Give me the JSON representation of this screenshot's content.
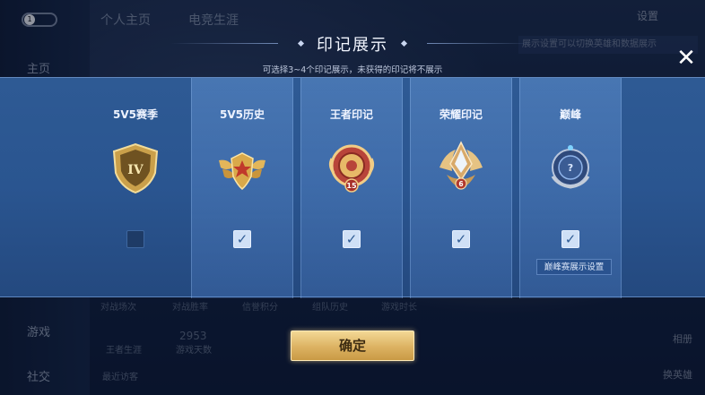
{
  "background": {
    "level_badge": "1",
    "tabs": [
      "个人主页",
      "电竞生涯"
    ],
    "side_items": [
      "主页",
      "游戏",
      "社交"
    ],
    "settings_label": "设置",
    "hint": "展示设置可以切换英雄和数据展示",
    "stats_labels": [
      "对战场次",
      "对战胜率",
      "信誉积分",
      "组队历史",
      "游戏时长"
    ],
    "game_days_value": "2953",
    "game_days_label": "游戏天数",
    "king_career": "王者生涯",
    "recent_visitors": "最近访客",
    "right_buttons": [
      "相册",
      "换英雄"
    ]
  },
  "dialog": {
    "title": "印记展示",
    "subtitle": "可选择3~4个印记展示，未获得的印记将不展示",
    "close_label": "✕",
    "confirm_label": "确定",
    "peak_settings_label": "巅峰赛展示设置",
    "columns": [
      {
        "title": "5V5赛季",
        "checked": false,
        "badge_text": "IV"
      },
      {
        "title": "5V5历史",
        "checked": true,
        "badge_text": ""
      },
      {
        "title": "王者印记",
        "checked": true,
        "badge_text": "15"
      },
      {
        "title": "荣耀印记",
        "checked": true,
        "badge_text": "6"
      },
      {
        "title": "巅峰",
        "checked": true,
        "badge_text": "?"
      }
    ]
  },
  "colors": {
    "panel": "#2a5590",
    "checkbox_on": "#cfe0f6",
    "confirm_gold": "#dcb262",
    "badge_gold": "#d9a94a",
    "badge_red": "#b83a2e"
  }
}
